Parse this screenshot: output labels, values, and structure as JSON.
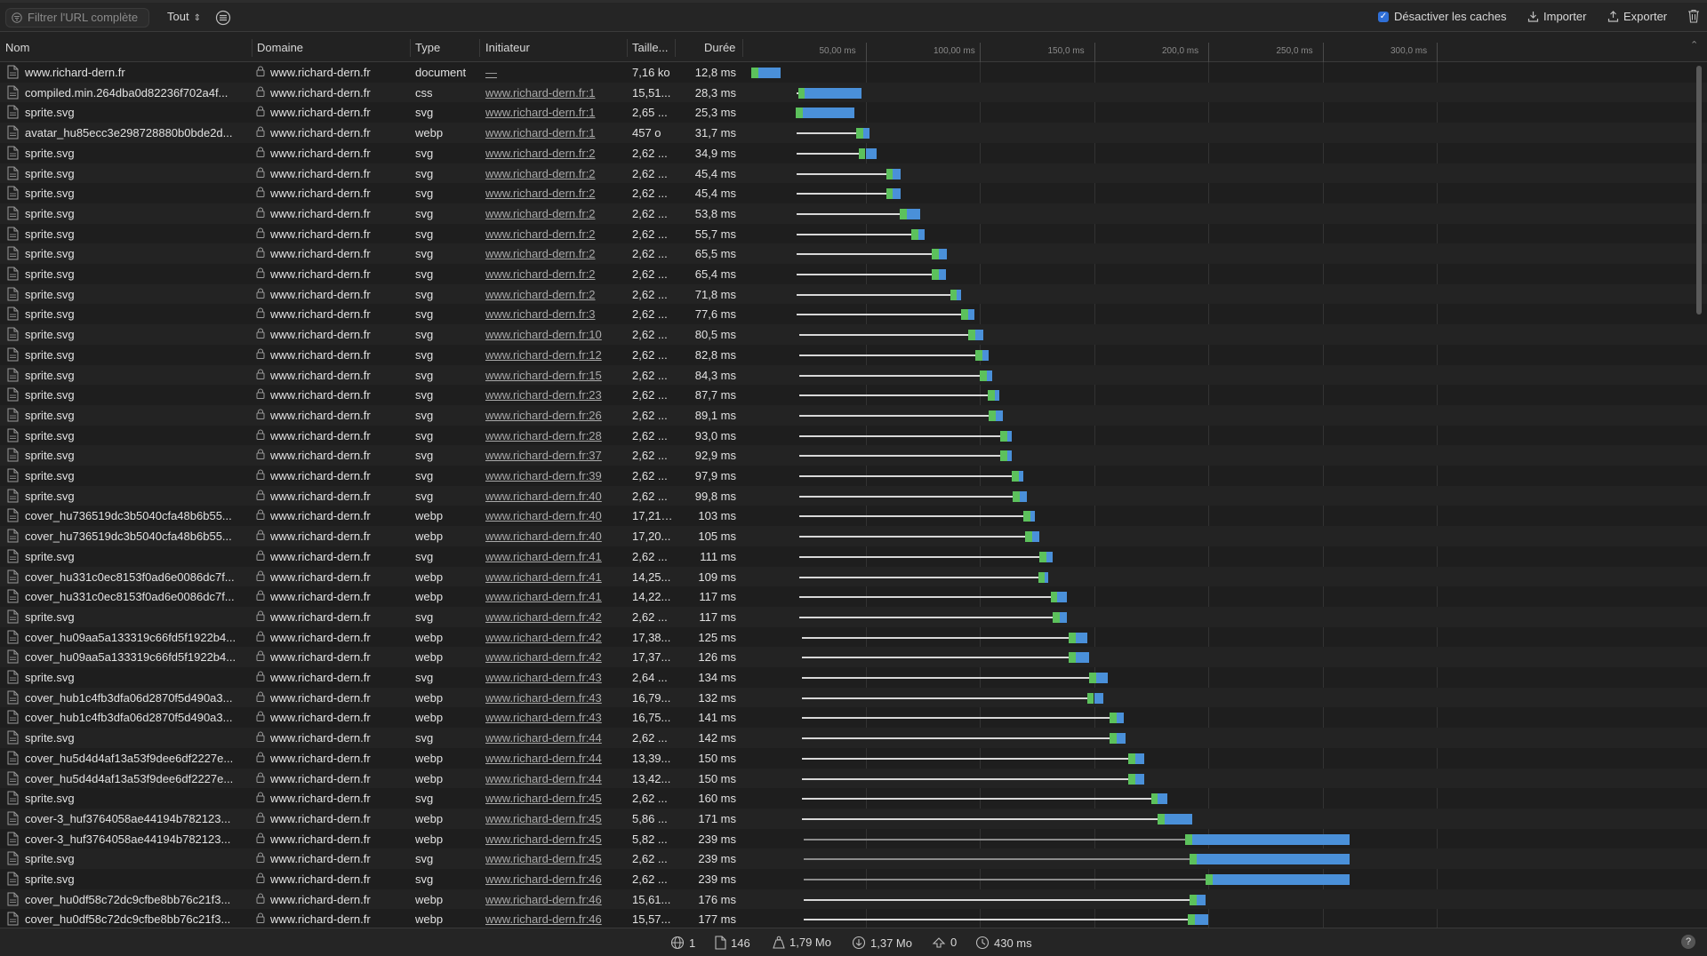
{
  "toolbar": {
    "filter_placeholder": "Filtrer l'URL complète",
    "type_filter": "Tout",
    "disable_cache_label": "Désactiver les caches",
    "disable_cache_checked": true,
    "import_label": "Importer",
    "export_label": "Exporter"
  },
  "columns": {
    "name": "Nom",
    "domain": "Domaine",
    "type": "Type",
    "initiator": "Initiateur",
    "size": "Taille...",
    "duration": "Durée"
  },
  "timeline_ticks": [
    "50,00 ms",
    "100,00 ms",
    "150,0 ms",
    "200,0 ms",
    "250,0 ms",
    "300,0 ms"
  ],
  "rows": [
    {
      "name": "www.richard-dern.fr",
      "domain": "www.richard-dern.fr",
      "type": "document",
      "initiator": "—",
      "size": "7,16 ko",
      "duration": "12,8 ms",
      "start": 0.0,
      "wait": 3.0,
      "recv": 9.8
    },
    {
      "name": "compiled.min.264dba0d82236f702a4f...",
      "domain": "www.richard-dern.fr",
      "type": "css",
      "initiator": "www.richard-dern.fr:1",
      "size": "15,51...",
      "duration": "28,3 ms",
      "start": 20.0,
      "wait": 3.5,
      "recv": 24.8
    },
    {
      "name": "sprite.svg",
      "domain": "www.richard-dern.fr",
      "type": "svg",
      "initiator": "www.richard-dern.fr:1",
      "size": "2,65 ...",
      "duration": "25,3 ms",
      "start": 20.0,
      "wait": 2.5,
      "recv": 22.8
    },
    {
      "name": "avatar_hu85ecc3e298728880b0bde2d...",
      "domain": "www.richard-dern.fr",
      "type": "webp",
      "initiator": "www.richard-dern.fr:1",
      "size": "457 o",
      "duration": "31,7 ms",
      "start": 20.0,
      "wait": 29.0,
      "recv": 2.7
    },
    {
      "name": "sprite.svg",
      "domain": "www.richard-dern.fr",
      "type": "svg",
      "initiator": "www.richard-dern.fr:2",
      "size": "2,62 ...",
      "duration": "34,9 ms",
      "start": 20.0,
      "wait": 30.0,
      "recv": 4.9
    },
    {
      "name": "sprite.svg",
      "domain": "www.richard-dern.fr",
      "type": "svg",
      "initiator": "www.richard-dern.fr:2",
      "size": "2,62 ...",
      "duration": "45,4 ms",
      "start": 20.0,
      "wait": 42.0,
      "recv": 3.4
    },
    {
      "name": "sprite.svg",
      "domain": "www.richard-dern.fr",
      "type": "svg",
      "initiator": "www.richard-dern.fr:2",
      "size": "2,62 ...",
      "duration": "45,4 ms",
      "start": 20.0,
      "wait": 42.0,
      "recv": 3.4
    },
    {
      "name": "sprite.svg",
      "domain": "www.richard-dern.fr",
      "type": "svg",
      "initiator": "www.richard-dern.fr:2",
      "size": "2,62 ...",
      "duration": "53,8 ms",
      "start": 20.0,
      "wait": 48.0,
      "recv": 5.8
    },
    {
      "name": "sprite.svg",
      "domain": "www.richard-dern.fr",
      "type": "svg",
      "initiator": "www.richard-dern.fr:2",
      "size": "2,62 ...",
      "duration": "55,7 ms",
      "start": 20.0,
      "wait": 53.0,
      "recv": 2.7
    },
    {
      "name": "sprite.svg",
      "domain": "www.richard-dern.fr",
      "type": "svg",
      "initiator": "www.richard-dern.fr:2",
      "size": "2,62 ...",
      "duration": "65,5 ms",
      "start": 20.0,
      "wait": 62.0,
      "recv": 3.5
    },
    {
      "name": "sprite.svg",
      "domain": "www.richard-dern.fr",
      "type": "svg",
      "initiator": "www.richard-dern.fr:2",
      "size": "2,62 ...",
      "duration": "65,4 ms",
      "start": 20.0,
      "wait": 62.0,
      "recv": 3.4
    },
    {
      "name": "sprite.svg",
      "domain": "www.richard-dern.fr",
      "type": "svg",
      "initiator": "www.richard-dern.fr:2",
      "size": "2,62 ...",
      "duration": "71,8 ms",
      "start": 20.0,
      "wait": 70.0,
      "recv": 1.8
    },
    {
      "name": "sprite.svg",
      "domain": "www.richard-dern.fr",
      "type": "svg",
      "initiator": "www.richard-dern.fr:3",
      "size": "2,62 ...",
      "duration": "77,6 ms",
      "start": 20.0,
      "wait": 75.0,
      "recv": 2.6
    },
    {
      "name": "sprite.svg",
      "domain": "www.richard-dern.fr",
      "type": "svg",
      "initiator": "www.richard-dern.fr:10",
      "size": "2,62 ...",
      "duration": "80,5 ms",
      "start": 21.0,
      "wait": 77.0,
      "recv": 3.5
    },
    {
      "name": "sprite.svg",
      "domain": "www.richard-dern.fr",
      "type": "svg",
      "initiator": "www.richard-dern.fr:12",
      "size": "2,62 ...",
      "duration": "82,8 ms",
      "start": 21.0,
      "wait": 80.0,
      "recv": 2.8
    },
    {
      "name": "sprite.svg",
      "domain": "www.richard-dern.fr",
      "type": "svg",
      "initiator": "www.richard-dern.fr:15",
      "size": "2,62 ...",
      "duration": "84,3 ms",
      "start": 21.0,
      "wait": 82.0,
      "recv": 2.3
    },
    {
      "name": "sprite.svg",
      "domain": "www.richard-dern.fr",
      "type": "svg",
      "initiator": "www.richard-dern.fr:23",
      "size": "2,62 ...",
      "duration": "87,7 ms",
      "start": 21.0,
      "wait": 85.5,
      "recv": 2.2
    },
    {
      "name": "sprite.svg",
      "domain": "www.richard-dern.fr",
      "type": "svg",
      "initiator": "www.richard-dern.fr:26",
      "size": "2,62 ...",
      "duration": "89,1 ms",
      "start": 21.0,
      "wait": 86.0,
      "recv": 3.1
    },
    {
      "name": "sprite.svg",
      "domain": "www.richard-dern.fr",
      "type": "svg",
      "initiator": "www.richard-dern.fr:28",
      "size": "2,62 ...",
      "duration": "93,0 ms",
      "start": 21.0,
      "wait": 91.0,
      "recv": 2.0
    },
    {
      "name": "sprite.svg",
      "domain": "www.richard-dern.fr",
      "type": "svg",
      "initiator": "www.richard-dern.fr:37",
      "size": "2,62 ...",
      "duration": "92,9 ms",
      "start": 21.0,
      "wait": 91.0,
      "recv": 1.9
    },
    {
      "name": "sprite.svg",
      "domain": "www.richard-dern.fr",
      "type": "svg",
      "initiator": "www.richard-dern.fr:39",
      "size": "2,62 ...",
      "duration": "97,9 ms",
      "start": 21.0,
      "wait": 96.0,
      "recv": 1.9
    },
    {
      "name": "sprite.svg",
      "domain": "www.richard-dern.fr",
      "type": "svg",
      "initiator": "www.richard-dern.fr:40",
      "size": "2,62 ...",
      "duration": "99,8 ms",
      "start": 21.0,
      "wait": 96.5,
      "recv": 3.3
    },
    {
      "name": "cover_hu736519dc3b5040cfa48b6b55...",
      "domain": "www.richard-dern.fr",
      "type": "webp",
      "initiator": "www.richard-dern.fr:40",
      "size": "17,21 ...",
      "duration": "103 ms",
      "start": 21.0,
      "wait": 101.0,
      "recv": 2.0
    },
    {
      "name": "cover_hu736519dc3b5040cfa48b6b55...",
      "domain": "www.richard-dern.fr",
      "type": "webp",
      "initiator": "www.richard-dern.fr:40",
      "size": "17,20...",
      "duration": "105 ms",
      "start": 21.0,
      "wait": 102.0,
      "recv": 3.0
    },
    {
      "name": "sprite.svg",
      "domain": "www.richard-dern.fr",
      "type": "svg",
      "initiator": "www.richard-dern.fr:41",
      "size": "2,62 ...",
      "duration": "111 ms",
      "start": 21.0,
      "wait": 108.0,
      "recv": 3.0
    },
    {
      "name": "cover_hu331c0ec8153f0ad6e0086dc7f...",
      "domain": "www.richard-dern.fr",
      "type": "webp",
      "initiator": "www.richard-dern.fr:41",
      "size": "14,25...",
      "duration": "109 ms",
      "start": 21.0,
      "wait": 107.5,
      "recv": 1.5
    },
    {
      "name": "cover_hu331c0ec8153f0ad6e0086dc7f...",
      "domain": "www.richard-dern.fr",
      "type": "webp",
      "initiator": "www.richard-dern.fr:41",
      "size": "14,22...",
      "duration": "117 ms",
      "start": 21.0,
      "wait": 113.0,
      "recv": 4.0
    },
    {
      "name": "sprite.svg",
      "domain": "www.richard-dern.fr",
      "type": "svg",
      "initiator": "www.richard-dern.fr:42",
      "size": "2,62 ...",
      "duration": "117 ms",
      "start": 21.0,
      "wait": 114.0,
      "recv": 3.0
    },
    {
      "name": "cover_hu09aa5a133319c66fd5f1922b4...",
      "domain": "www.richard-dern.fr",
      "type": "webp",
      "initiator": "www.richard-dern.fr:42",
      "size": "17,38...",
      "duration": "125 ms",
      "start": 22.0,
      "wait": 120.0,
      "recv": 5.0
    },
    {
      "name": "cover_hu09aa5a133319c66fd5f1922b4...",
      "domain": "www.richard-dern.fr",
      "type": "webp",
      "initiator": "www.richard-dern.fr:42",
      "size": "17,37...",
      "duration": "126 ms",
      "start": 22.0,
      "wait": 120.0,
      "recv": 6.0
    },
    {
      "name": "sprite.svg",
      "domain": "www.richard-dern.fr",
      "type": "svg",
      "initiator": "www.richard-dern.fr:43",
      "size": "2,64 ...",
      "duration": "134 ms",
      "start": 22.0,
      "wait": 129.0,
      "recv": 5.0
    },
    {
      "name": "cover_hub1c4fb3dfa06d2870f5d490a3...",
      "domain": "www.richard-dern.fr",
      "type": "webp",
      "initiator": "www.richard-dern.fr:43",
      "size": "16,79...",
      "duration": "132 ms",
      "start": 22.0,
      "wait": 128.0,
      "recv": 4.0
    },
    {
      "name": "cover_hub1c4fb3dfa06d2870f5d490a3...",
      "domain": "www.richard-dern.fr",
      "type": "webp",
      "initiator": "www.richard-dern.fr:43",
      "size": "16,75...",
      "duration": "141 ms",
      "start": 22.0,
      "wait": 138.0,
      "recv": 3.0
    },
    {
      "name": "sprite.svg",
      "domain": "www.richard-dern.fr",
      "type": "svg",
      "initiator": "www.richard-dern.fr:44",
      "size": "2,62 ...",
      "duration": "142 ms",
      "start": 22.0,
      "wait": 138.0,
      "recv": 4.0
    },
    {
      "name": "cover_hu5d4d4af13a53f9dee6df2227e...",
      "domain": "www.richard-dern.fr",
      "type": "webp",
      "initiator": "www.richard-dern.fr:44",
      "size": "13,39...",
      "duration": "150 ms",
      "start": 22.0,
      "wait": 146.0,
      "recv": 4.0
    },
    {
      "name": "cover_hu5d4d4af13a53f9dee6df2227e...",
      "domain": "www.richard-dern.fr",
      "type": "webp",
      "initiator": "www.richard-dern.fr:44",
      "size": "13,42...",
      "duration": "150 ms",
      "start": 22.0,
      "wait": 146.0,
      "recv": 4.0
    },
    {
      "name": "sprite.svg",
      "domain": "www.richard-dern.fr",
      "type": "svg",
      "initiator": "www.richard-dern.fr:45",
      "size": "2,62 ...",
      "duration": "160 ms",
      "start": 22.0,
      "wait": 156.0,
      "recv": 4.0
    },
    {
      "name": "cover-3_huf3764058ae44194b782123...",
      "domain": "www.richard-dern.fr",
      "type": "webp",
      "initiator": "www.richard-dern.fr:45",
      "size": "5,86 ...",
      "duration": "171 ms",
      "start": 22.0,
      "wait": 159.0,
      "recv": 12.0
    },
    {
      "name": "cover-3_huf3764058ae44194b782123...",
      "domain": "www.richard-dern.fr",
      "type": "webp",
      "initiator": "www.richard-dern.fr:45",
      "size": "5,82 ...",
      "duration": "239 ms",
      "start": 23.0,
      "wait": 170.0,
      "recv": 69.0
    },
    {
      "name": "sprite.svg",
      "domain": "www.richard-dern.fr",
      "type": "svg",
      "initiator": "www.richard-dern.fr:45",
      "size": "2,62 ...",
      "duration": "239 ms",
      "start": 23.0,
      "wait": 172.0,
      "recv": 67.0
    },
    {
      "name": "sprite.svg",
      "domain": "www.richard-dern.fr",
      "type": "svg",
      "initiator": "www.richard-dern.fr:46",
      "size": "2,62 ...",
      "duration": "239 ms",
      "start": 23.0,
      "wait": 179.0,
      "recv": 60.0
    },
    {
      "name": "cover_hu0df58c72dc9cfbe8bb76c21f3...",
      "domain": "www.richard-dern.fr",
      "type": "webp",
      "initiator": "www.richard-dern.fr:46",
      "size": "15,61...",
      "duration": "176 ms",
      "start": 23.0,
      "wait": 172.0,
      "recv": 4.0
    },
    {
      "name": "cover_hu0df58c72dc9cfbe8bb76c21f3...",
      "domain": "www.richard-dern.fr",
      "type": "webp",
      "initiator": "www.richard-dern.fr:46",
      "size": "15,57...",
      "duration": "177 ms",
      "start": 23.0,
      "wait": 171.0,
      "recv": 6.0
    }
  ],
  "status": {
    "domains": "1",
    "requests": "146",
    "transferred": "1,79 Mo",
    "resources": "1,37 Mo",
    "redirects": "0",
    "load_time": "430 ms"
  },
  "colors": {
    "waiting": "#5cc15c",
    "receiving": "#4a90d9",
    "accent": "#2f6fd6"
  }
}
